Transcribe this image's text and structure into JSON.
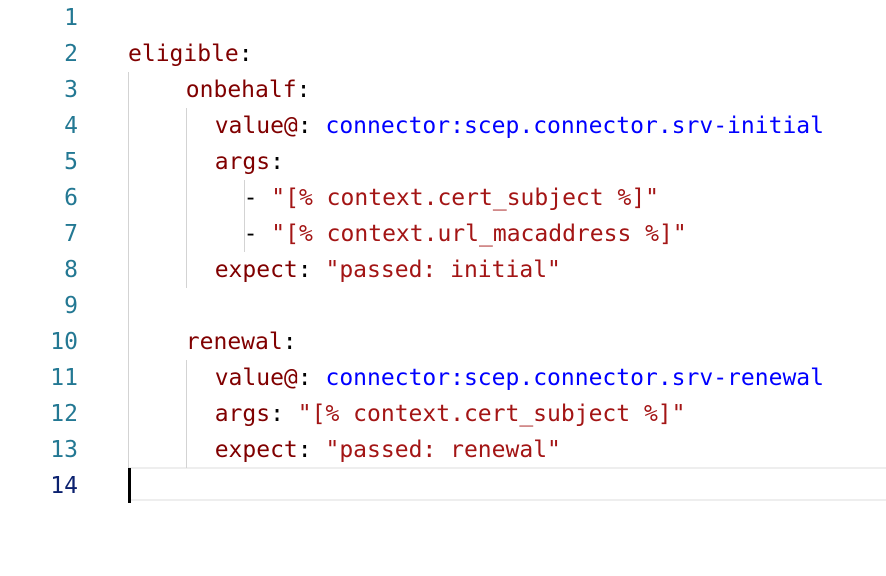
{
  "editor": {
    "lines": [
      {
        "num": "1",
        "indent": 0,
        "tokens": []
      },
      {
        "num": "2",
        "indent": 0,
        "tokens": [
          {
            "t": "k",
            "v": "eligible"
          },
          {
            "t": "p",
            "v": ":"
          }
        ]
      },
      {
        "num": "3",
        "indent": 4,
        "tokens": [
          {
            "t": "k",
            "v": "onbehalf"
          },
          {
            "t": "p",
            "v": ":"
          }
        ]
      },
      {
        "num": "4",
        "indent": 6,
        "tokens": [
          {
            "t": "k",
            "v": "value@"
          },
          {
            "t": "p",
            "v": ": "
          },
          {
            "t": "v",
            "v": "connector:scep.connector.srv-initial"
          }
        ]
      },
      {
        "num": "5",
        "indent": 6,
        "tokens": [
          {
            "t": "k",
            "v": "args"
          },
          {
            "t": "p",
            "v": ":"
          }
        ]
      },
      {
        "num": "6",
        "indent": 8,
        "tokens": [
          {
            "t": "p",
            "v": "- "
          },
          {
            "t": "s",
            "v": "\"[% context.cert_subject %]\""
          }
        ]
      },
      {
        "num": "7",
        "indent": 8,
        "tokens": [
          {
            "t": "p",
            "v": "- "
          },
          {
            "t": "s",
            "v": "\"[% context.url_macaddress %]\""
          }
        ]
      },
      {
        "num": "8",
        "indent": 6,
        "tokens": [
          {
            "t": "k",
            "v": "expect"
          },
          {
            "t": "p",
            "v": ": "
          },
          {
            "t": "s",
            "v": "\"passed: initial\""
          }
        ]
      },
      {
        "num": "9",
        "indent": 0,
        "tokens": []
      },
      {
        "num": "10",
        "indent": 4,
        "tokens": [
          {
            "t": "k",
            "v": "renewal"
          },
          {
            "t": "p",
            "v": ":"
          }
        ]
      },
      {
        "num": "11",
        "indent": 6,
        "tokens": [
          {
            "t": "k",
            "v": "value@"
          },
          {
            "t": "p",
            "v": ": "
          },
          {
            "t": "v",
            "v": "connector:scep.connector.srv-renewal"
          }
        ]
      },
      {
        "num": "12",
        "indent": 6,
        "tokens": [
          {
            "t": "k",
            "v": "args"
          },
          {
            "t": "p",
            "v": ": "
          },
          {
            "t": "s",
            "v": "\"[% context.cert_subject %]\""
          }
        ]
      },
      {
        "num": "13",
        "indent": 6,
        "tokens": [
          {
            "t": "k",
            "v": "expect"
          },
          {
            "t": "p",
            "v": ": "
          },
          {
            "t": "s",
            "v": "\"passed: renewal\""
          }
        ]
      },
      {
        "num": "14",
        "indent": 0,
        "tokens": [],
        "active": true
      }
    ],
    "colors": {
      "key": "#800000",
      "value": "#0000ff",
      "string": "#a31515",
      "line_number": "#237893",
      "active_line_number": "#0b216f"
    }
  }
}
